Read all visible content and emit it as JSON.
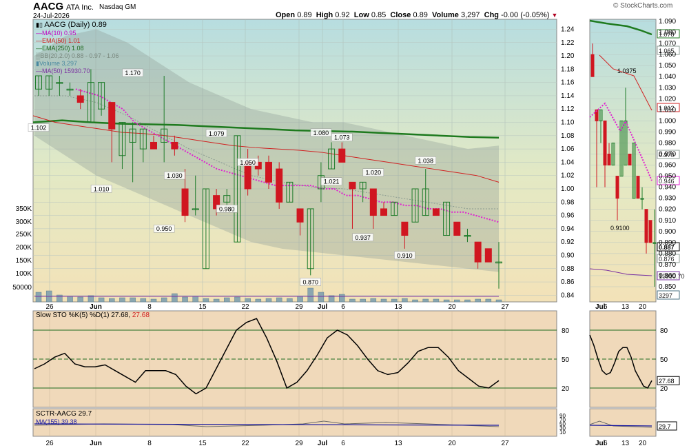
{
  "header": {
    "symbol": "AACG",
    "company": "ATA Inc.",
    "exchange": "Nasdaq GM",
    "date": "24-Jul-2026",
    "brand": "© StockCharts.com",
    "open_label": "Open",
    "open": "0.89",
    "high_label": "High",
    "high": "0.92",
    "low_label": "Low",
    "low": "0.85",
    "close_label": "Close",
    "close": "0.89",
    "volume_label": "Volume",
    "volume": "3,297",
    "chg_label": "Chg",
    "chg": "-0.00 (-0.05%)"
  },
  "legend": {
    "main": "AACG (Daily) 0.89",
    "ma10": "MA(10) 0.95",
    "ema50": "EMA(50) 1.01",
    "ema250": "EMA(250) 1.08",
    "bb": "BB(20,2.0) 0.88 - 0.97 - 1.06",
    "volume": "Volume 3,297",
    "ma50vol": "MA(50) 15930.70",
    "sto_a": "Slow STO %K(5) %D(1) 27.68,",
    "sto_b": "27.68",
    "sctr": "SCTR-AACG 29.7",
    "sctr_ma": "MA(155) 39.38"
  },
  "colors": {
    "up": "#1e7b2a",
    "down": "#d01620",
    "ma10": "#e020d0",
    "ema50": "#d02020",
    "ema250": "#1e7a1e",
    "bb": "#8c9c94",
    "volume": "#8aa6b0",
    "sto": "#000000",
    "sctr": "#000000",
    "sctr_ma": "#1a1aa0"
  },
  "chart_data": [
    {
      "type": "candlestick",
      "title": "AACG ATA Inc. Nasdaq GM",
      "ylim": [
        0.83,
        1.255
      ],
      "y_ticks": [
        1.24,
        1.22,
        1.2,
        1.18,
        1.16,
        1.14,
        1.12,
        1.1,
        1.08,
        1.06,
        1.04,
        1.02,
        1.0,
        0.98,
        0.96,
        0.94,
        0.92,
        0.9,
        0.88,
        0.86,
        0.84
      ],
      "x_labels": [
        "26",
        "Jun",
        "8",
        "15",
        "22",
        "29",
        "Jul",
        "6",
        "13",
        "20",
        "27"
      ],
      "candles": [
        {
          "d": "2026-05-22",
          "o": 1.15,
          "h": 1.17,
          "l": 1.14,
          "c": 1.17
        },
        {
          "d": "2026-05-25",
          "o": 1.15,
          "h": 1.17,
          "l": 1.14,
          "c": 1.17
        },
        {
          "d": "2026-05-26",
          "o": 1.16,
          "h": 1.17,
          "l": 1.14,
          "c": 1.16
        },
        {
          "d": "2026-05-27",
          "o": 1.15,
          "h": 1.16,
          "l": 1.14,
          "c": 1.15
        },
        {
          "d": "2026-05-28",
          "o": 1.14,
          "h": 1.15,
          "l": 1.12,
          "c": 1.13
        },
        {
          "d": "2026-05-29",
          "o": 1.1,
          "h": 1.18,
          "l": 1.1,
          "c": 1.16
        },
        {
          "d": "2026-06-01",
          "o": 1.12,
          "h": 1.16,
          "l": 1.11,
          "c": 1.16
        },
        {
          "d": "2026-06-02",
          "o": 1.13,
          "h": 1.13,
          "l": 1.04,
          "c": 1.09
        },
        {
          "d": "2026-06-03",
          "o": 1.05,
          "h": 1.1,
          "l": 1.03,
          "c": 1.1
        },
        {
          "d": "2026-06-04",
          "o": 1.07,
          "h": 1.1,
          "l": 1.01,
          "c": 1.09
        },
        {
          "d": "2026-06-05",
          "o": 1.06,
          "h": 1.09,
          "l": 1.04,
          "c": 1.09
        },
        {
          "d": "2026-06-08",
          "o": 1.07,
          "h": 1.08,
          "l": 1.06,
          "c": 1.06
        },
        {
          "d": "2026-06-09",
          "o": 1.07,
          "h": 1.17,
          "l": 1.04,
          "c": 1.09
        },
        {
          "d": "2026-06-10",
          "o": 1.07,
          "h": 1.08,
          "l": 1.05,
          "c": 1.06
        },
        {
          "d": "2026-06-11",
          "o": 1.0,
          "h": 1.03,
          "l": 0.95,
          "c": 0.96
        },
        {
          "d": "2026-06-12",
          "o": 0.97,
          "h": 1.02,
          "l": 0.96,
          "c": 0.97
        },
        {
          "d": "2026-06-15",
          "o": 0.88,
          "h": 1.0,
          "l": 0.88,
          "c": 1.0
        },
        {
          "d": "2026-06-16",
          "o": 0.99,
          "h": 1.0,
          "l": 0.96,
          "c": 0.97
        },
        {
          "d": "2026-06-17",
          "o": 0.98,
          "h": 1.0,
          "l": 0.97,
          "c": 0.99
        },
        {
          "d": "2026-06-18",
          "o": 0.92,
          "h": 1.08,
          "l": 0.92,
          "c": 1.08
        },
        {
          "d": "2026-06-19",
          "o": 1.04,
          "h": 1.06,
          "l": 0.99,
          "c": 1.0
        },
        {
          "d": "2026-06-22",
          "o": 1.04,
          "h": 1.05,
          "l": 1.02,
          "c": 1.03
        },
        {
          "d": "2026-06-23",
          "o": 1.04,
          "h": 1.05,
          "l": 1.0,
          "c": 1.01
        },
        {
          "d": "2026-06-24",
          "o": 1.03,
          "h": 1.04,
          "l": 0.97,
          "c": 0.98
        },
        {
          "d": "2026-06-25",
          "o": 0.98,
          "h": 1.01,
          "l": 0.98,
          "c": 1.01
        },
        {
          "d": "2026-06-26",
          "o": 0.97,
          "h": 0.97,
          "l": 0.93,
          "c": 0.95
        },
        {
          "d": "2026-06-29",
          "o": 0.88,
          "h": 0.97,
          "l": 0.87,
          "c": 0.97
        },
        {
          "d": "2026-06-30",
          "o": 1.0,
          "h": 1.04,
          "l": 0.98,
          "c": 1.02
        },
        {
          "d": "2026-07-01",
          "o": 1.03,
          "h": 1.07,
          "l": 1.03,
          "c": 1.06
        },
        {
          "d": "2026-07-02",
          "o": 1.06,
          "h": 1.07,
          "l": 1.04,
          "c": 1.04
        },
        {
          "d": "2026-07-06",
          "o": 1.01,
          "h": 1.01,
          "l": 0.94,
          "c": 1.0
        },
        {
          "d": "2026-07-07",
          "o": 1.0,
          "h": 1.01,
          "l": 0.98,
          "c": 1.01
        },
        {
          "d": "2026-07-08",
          "o": 1.0,
          "h": 1.0,
          "l": 0.94,
          "c": 0.96
        },
        {
          "d": "2026-07-09",
          "o": 0.97,
          "h": 0.98,
          "l": 0.96,
          "c": 0.96
        },
        {
          "d": "2026-07-10",
          "o": 0.96,
          "h": 0.98,
          "l": 0.96,
          "c": 0.98
        },
        {
          "d": "2026-07-13",
          "o": 0.95,
          "h": 0.95,
          "l": 0.91,
          "c": 0.93
        },
        {
          "d": "2026-07-14",
          "o": 0.95,
          "h": 1.0,
          "l": 0.95,
          "c": 1.0
        },
        {
          "d": "2026-07-15",
          "o": 0.96,
          "h": 1.03,
          "l": 0.96,
          "c": 1.0
        },
        {
          "d": "2026-07-16",
          "o": 0.97,
          "h": 0.97,
          "l": 0.96,
          "c": 0.96
        },
        {
          "d": "2026-07-17",
          "o": 0.93,
          "h": 0.98,
          "l": 0.93,
          "c": 0.98
        },
        {
          "d": "2026-07-20",
          "o": 0.95,
          "h": 0.95,
          "l": 0.93,
          "c": 0.93
        },
        {
          "d": "2026-07-21",
          "o": 0.93,
          "h": 0.94,
          "l": 0.92,
          "c": 0.93
        },
        {
          "d": "2026-07-22",
          "o": 0.92,
          "h": 0.92,
          "l": 0.88,
          "c": 0.89
        },
        {
          "d": "2026-07-23",
          "o": 0.91,
          "h": 0.91,
          "l": 0.89,
          "c": 0.89
        },
        {
          "d": "2026-07-24",
          "o": 0.89,
          "h": 0.92,
          "l": 0.85,
          "c": 0.89
        }
      ],
      "annotations": [
        {
          "i": 0,
          "value": "1.102"
        },
        {
          "i": 6,
          "value": "1.010"
        },
        {
          "i": 9,
          "value": "1.170"
        },
        {
          "i": 12,
          "value": "0.950"
        },
        {
          "i": 13,
          "value": "1.030"
        },
        {
          "i": 17,
          "value": "1.079"
        },
        {
          "i": 18,
          "value": "0.980"
        },
        {
          "i": 20,
          "value": "1.050"
        },
        {
          "i": 26,
          "value": "0.870"
        },
        {
          "i": 27,
          "value": "1.080"
        },
        {
          "i": 28,
          "value": "1.021"
        },
        {
          "i": 29,
          "value": "1.073"
        },
        {
          "i": 31,
          "value": "0.937"
        },
        {
          "i": 32,
          "value": "1.020"
        },
        {
          "i": 35,
          "value": "0.910"
        },
        {
          "i": 37,
          "value": "1.038"
        }
      ],
      "ma10": [
        1.15,
        1.145,
        1.14,
        1.13,
        1.12,
        1.1,
        1.09,
        1.08,
        1.07,
        1.06,
        1.05,
        1.04,
        1.03,
        1.025,
        1.02,
        1.015,
        1.01,
        1.005,
        1.005,
        1.005,
        1.005,
        1.0,
        1.0,
        0.99,
        0.99,
        0.985,
        0.98,
        0.98,
        0.975,
        0.975,
        0.97,
        0.97,
        0.965,
        0.965,
        0.96,
        0.955,
        0.95
      ],
      "ema50": [
        1.11,
        1.1,
        1.095,
        1.09,
        1.085,
        1.083,
        1.08,
        1.075,
        1.07,
        1.065,
        1.062,
        1.06,
        1.058,
        1.055,
        1.05,
        1.045,
        1.04,
        1.035,
        1.03,
        1.025,
        1.02,
        1.01
      ],
      "ema250": [
        1.1,
        1.103,
        1.1,
        1.098,
        1.097,
        1.096,
        1.094,
        1.092,
        1.09,
        1.088,
        1.087,
        1.086,
        1.084,
        1.082,
        1.08,
        1.078,
        1.077
      ],
      "bb_upper": [
        1.2,
        1.23,
        1.24,
        1.22,
        1.19,
        1.16,
        1.14,
        1.12,
        1.11,
        1.1,
        1.1,
        1.09,
        1.08,
        1.07,
        1.06,
        1.065
      ],
      "bb_lower": [
        1.08,
        1.05,
        1.02,
        1.0,
        0.98,
        0.96,
        0.94,
        0.92,
        0.91,
        0.905,
        0.9,
        0.895,
        0.89,
        0.885,
        0.88,
        0.875
      ],
      "volume": {
        "axis_labels": [
          "350K",
          "300K",
          "250K",
          "200K",
          "150K",
          "100K",
          "50000"
        ],
        "ma50": "15930.70"
      },
      "right_markers": [
        {
          "value": "1.078",
          "color": "#1e7a1e"
        },
        {
          "value": "1.065",
          "color": "#8c9c94"
        },
        {
          "value": "1.012",
          "color": "#d02020"
        },
        {
          "value": "0.970",
          "color": "#8c9c94"
        },
        {
          "value": "0.946",
          "color": "#e020d0"
        },
        {
          "value": "0.887",
          "color": "#000000"
        },
        {
          "value": "0.876",
          "color": "#8c9c94"
        },
        {
          "value": "15930.70",
          "color": "#7a30a0"
        },
        {
          "value": "3297",
          "color": "#4a7080"
        }
      ],
      "zoom_x_labels": [
        "Jul",
        "6",
        "13",
        "20"
      ],
      "zoom_annotations": [
        "1.0375",
        "0.9100"
      ],
      "zoom_y_ticks": [
        "1.090",
        "1.080",
        "1.070",
        "1.060",
        "1.050",
        "1.040",
        "1.030",
        "1.020",
        "1.010",
        "1.000",
        "0.990",
        "0.980",
        "0.970",
        "0.960",
        "0.950",
        "0.940",
        "0.930",
        "0.920",
        "0.910",
        "0.900",
        "0.890",
        "0.880",
        "0.870",
        "0.860",
        "0.850"
      ]
    },
    {
      "type": "line",
      "title": "Slow STO %K(5) %D(1) 27.68, 27.68",
      "ylim": [
        0,
        100
      ],
      "levels": [
        80,
        50,
        20
      ],
      "k": [
        40,
        45,
        52,
        56,
        45,
        42,
        42,
        44,
        38,
        32,
        26,
        38,
        38,
        38,
        34,
        22,
        14,
        20,
        40,
        60,
        80,
        88,
        92,
        72,
        48,
        20,
        26,
        38,
        54,
        72,
        80,
        75,
        64,
        50,
        38,
        34,
        36,
        46,
        58,
        62,
        62,
        52,
        38,
        30,
        22,
        20,
        27.68
      ],
      "last": "27.68"
    },
    {
      "type": "line",
      "title": "SCTR-AACG 29.7",
      "ma_label": "MA(155) 39.38",
      "right_value": "29.7",
      "ticks": [
        "90",
        "70",
        "50",
        "30",
        "10"
      ]
    }
  ]
}
